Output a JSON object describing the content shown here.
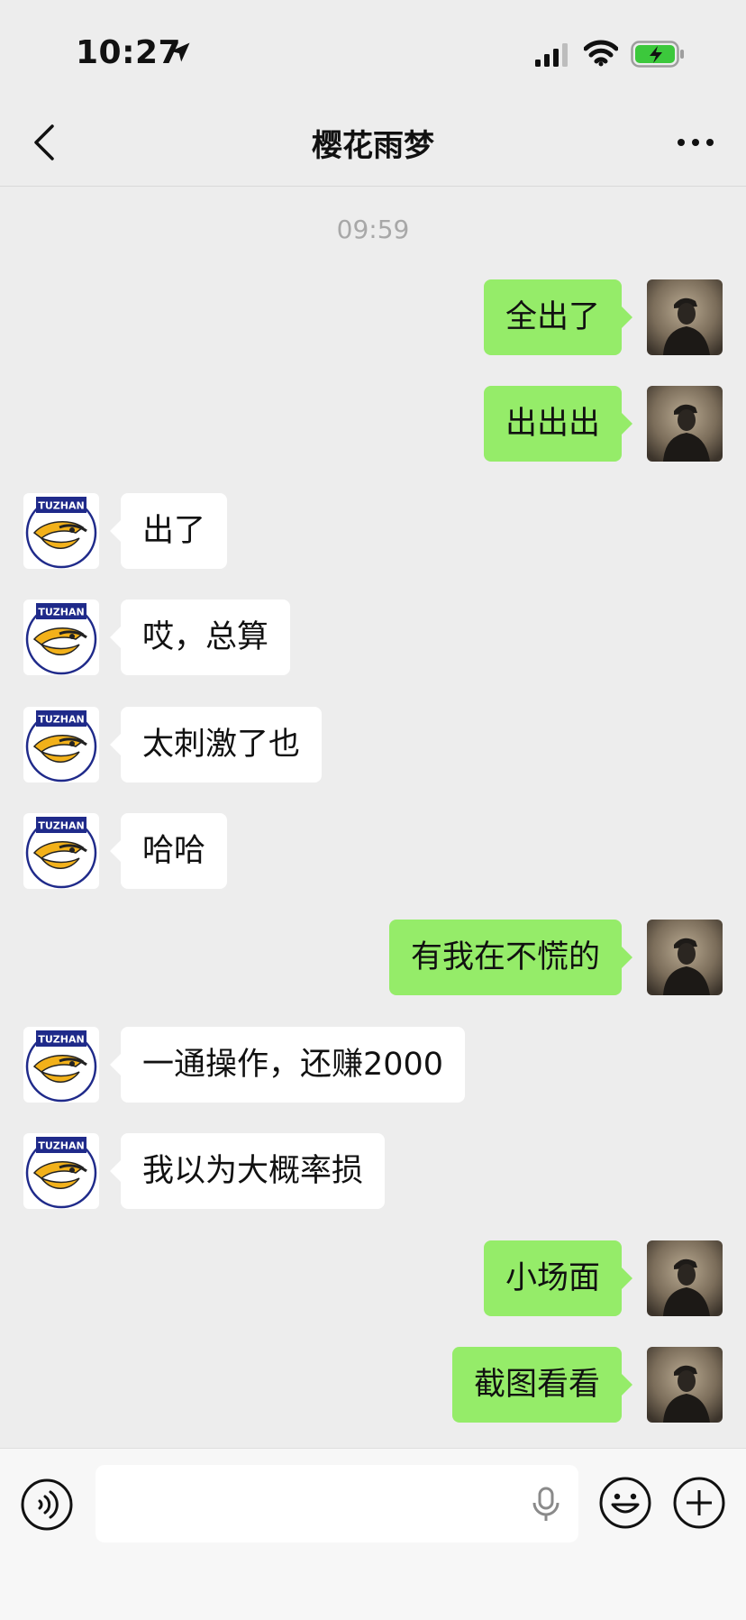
{
  "status_bar": {
    "time": "10:27",
    "icons": [
      "location-arrow-icon",
      "cellular-signal-icon",
      "wifi-icon",
      "battery-charging-icon"
    ]
  },
  "nav": {
    "title": "樱花雨梦",
    "back_icon": "chevron-left-icon",
    "more_icon": "more-dots-icon"
  },
  "chat": {
    "timestamp": "09:59",
    "messages": [
      {
        "side": "out",
        "text": "全出了"
      },
      {
        "side": "out",
        "text": "出出出"
      },
      {
        "side": "in",
        "text": "出了"
      },
      {
        "side": "in",
        "text": "哎，总算"
      },
      {
        "side": "in",
        "text": "太刺激了也"
      },
      {
        "side": "in",
        "text": "哈哈"
      },
      {
        "side": "out",
        "text": "有我在不慌的"
      },
      {
        "side": "in",
        "text": "一通操作，还赚2000"
      },
      {
        "side": "in",
        "text": "我以为大概率损"
      },
      {
        "side": "out",
        "text": "小场面"
      },
      {
        "side": "out",
        "text": "截图看看"
      }
    ],
    "incoming_avatar": {
      "badge_text": "TUZHAN",
      "icon": "eagle-logo-icon"
    },
    "outgoing_avatar": {
      "icon": "man-in-cap-photo-icon"
    }
  },
  "input_bar": {
    "value": "",
    "icons": [
      "voice-mode-icon",
      "microphone-icon",
      "emoji-icon",
      "add-plus-icon"
    ]
  },
  "colors": {
    "background": "#ededed",
    "outgoing_bubble": "#95ec69",
    "incoming_bubble": "#ffffff",
    "badge_blue": "#1f2a8a",
    "eagle_yellow": "#f2b11a"
  }
}
